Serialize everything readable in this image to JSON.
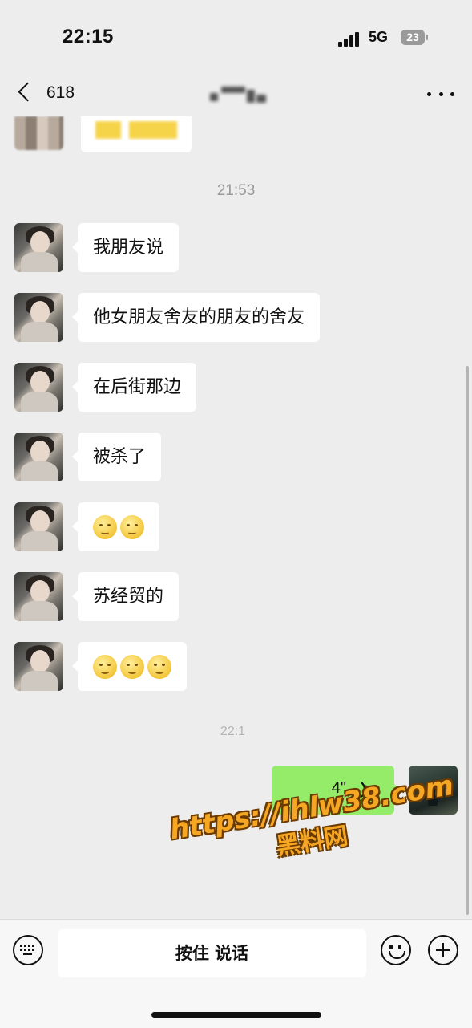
{
  "status_bar": {
    "time": "22:15",
    "network": "5G",
    "battery": "23",
    "signal_icon": "cellular-signal-icon"
  },
  "nav": {
    "back_icon": "chevron-left-icon",
    "unread_count": "618",
    "more_icon": "more-dots-icon"
  },
  "messages": [
    {
      "text": "我朋友说"
    },
    {
      "text": "他女朋友舍友的朋友的舍友"
    },
    {
      "text": "在后街那边"
    },
    {
      "text": "被杀了"
    },
    {
      "emoji": "smile-emoji",
      "count": 2
    },
    {
      "text": "苏经贸的"
    },
    {
      "emoji": "smile-emoji",
      "count": 3
    }
  ],
  "timestamps": {
    "first": "21:53",
    "second": "22:1"
  },
  "voice_message": {
    "duration": "4\"",
    "icon": "voice-wave-icon"
  },
  "watermark": {
    "url": "https://ihlw38.com",
    "name": "黑料网"
  },
  "input_bar": {
    "hold_to_talk": "按住 说话",
    "keyboard_icon": "keyboard-icon",
    "emoji_icon": "emoji-face-icon",
    "plus_icon": "plus-circle-icon"
  },
  "colors": {
    "background": "#ededed",
    "sent_bubble": "#95ec69",
    "received_bubble": "#ffffff",
    "watermark": "#f5a623"
  }
}
